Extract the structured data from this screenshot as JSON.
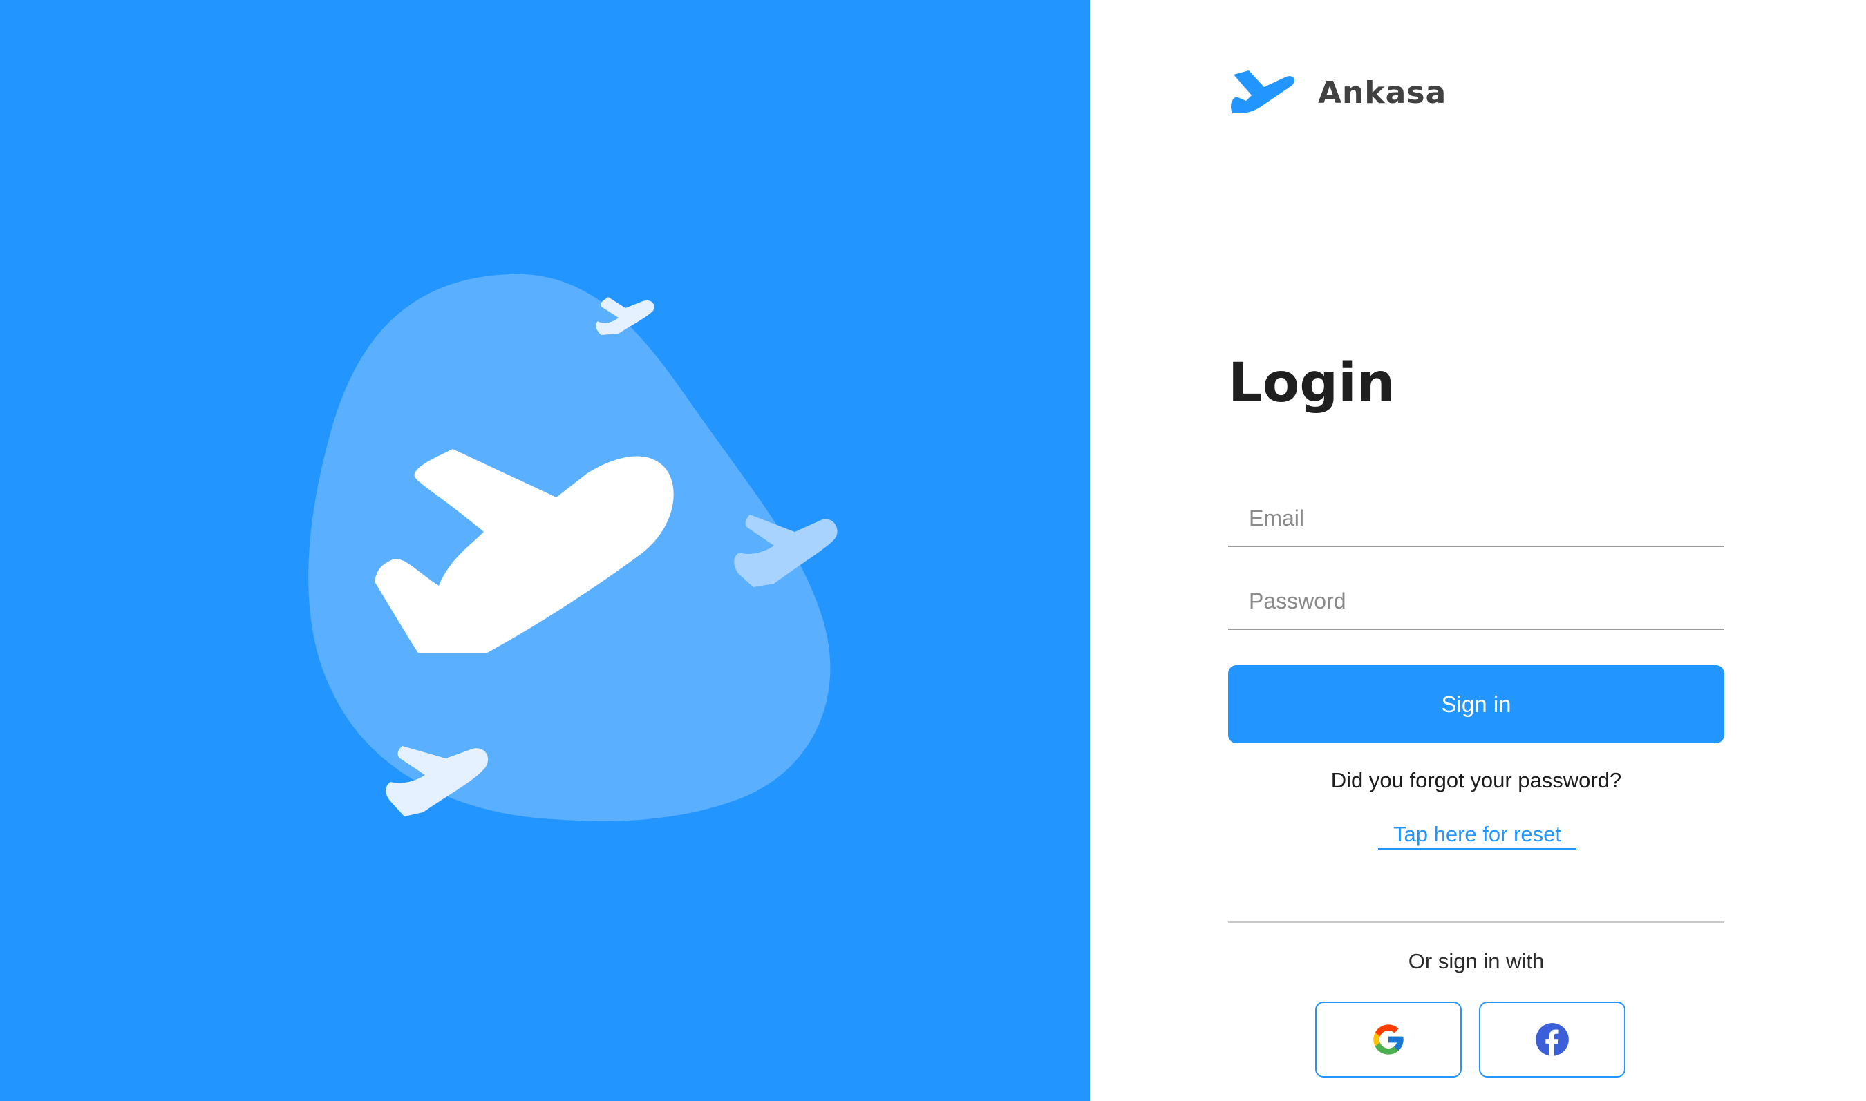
{
  "app": {
    "brand_name": "Ankasa",
    "brand_icon": "plane-logo-icon",
    "accent_color": "#2395FF"
  },
  "hero": {
    "background_color": "#2395FF",
    "illustration": "airplanes-blob-illustration"
  },
  "login": {
    "title": "Login",
    "email_placeholder": "Email",
    "email_value": "",
    "password_placeholder": "Password",
    "password_value": "",
    "signin_label": "Sign in",
    "forgot_text": "Did you forgot your password?",
    "reset_link_label": "Tap here for reset",
    "alt_signin_text": "Or sign in with",
    "social_buttons": [
      {
        "name": "google",
        "icon": "google-icon"
      },
      {
        "name": "facebook",
        "icon": "facebook-icon"
      }
    ]
  }
}
